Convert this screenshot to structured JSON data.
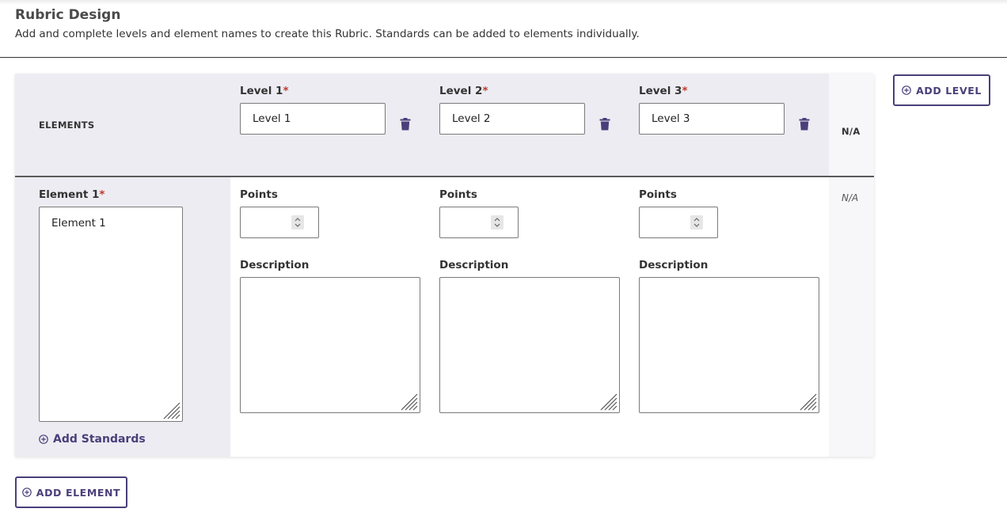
{
  "page": {
    "title": "Rubric Design",
    "subtitle": "Add and complete levels and element names to create this Rubric. Standards can be added to elements individually."
  },
  "header": {
    "elements_label": "ELEMENTS",
    "na_label": "N/A",
    "levels": [
      {
        "label": "Level 1",
        "required_mark": "*",
        "value": "Level 1"
      },
      {
        "label": "Level 2",
        "required_mark": "*",
        "value": "Level 2"
      },
      {
        "label": "Level 3",
        "required_mark": "*",
        "value": "Level 3"
      }
    ]
  },
  "element": {
    "label": "Element 1",
    "required_mark": "*",
    "value": "Element 1",
    "points_label": "Points",
    "description_label": "Description",
    "na_text": "N/A",
    "add_standards_label": "Add Standards"
  },
  "buttons": {
    "add_level": "ADD LEVEL",
    "add_element": "ADD ELEMENT"
  },
  "colors": {
    "accent": "#4a3f7a",
    "required": "#c0392b",
    "header_bg": "#edecf2"
  }
}
